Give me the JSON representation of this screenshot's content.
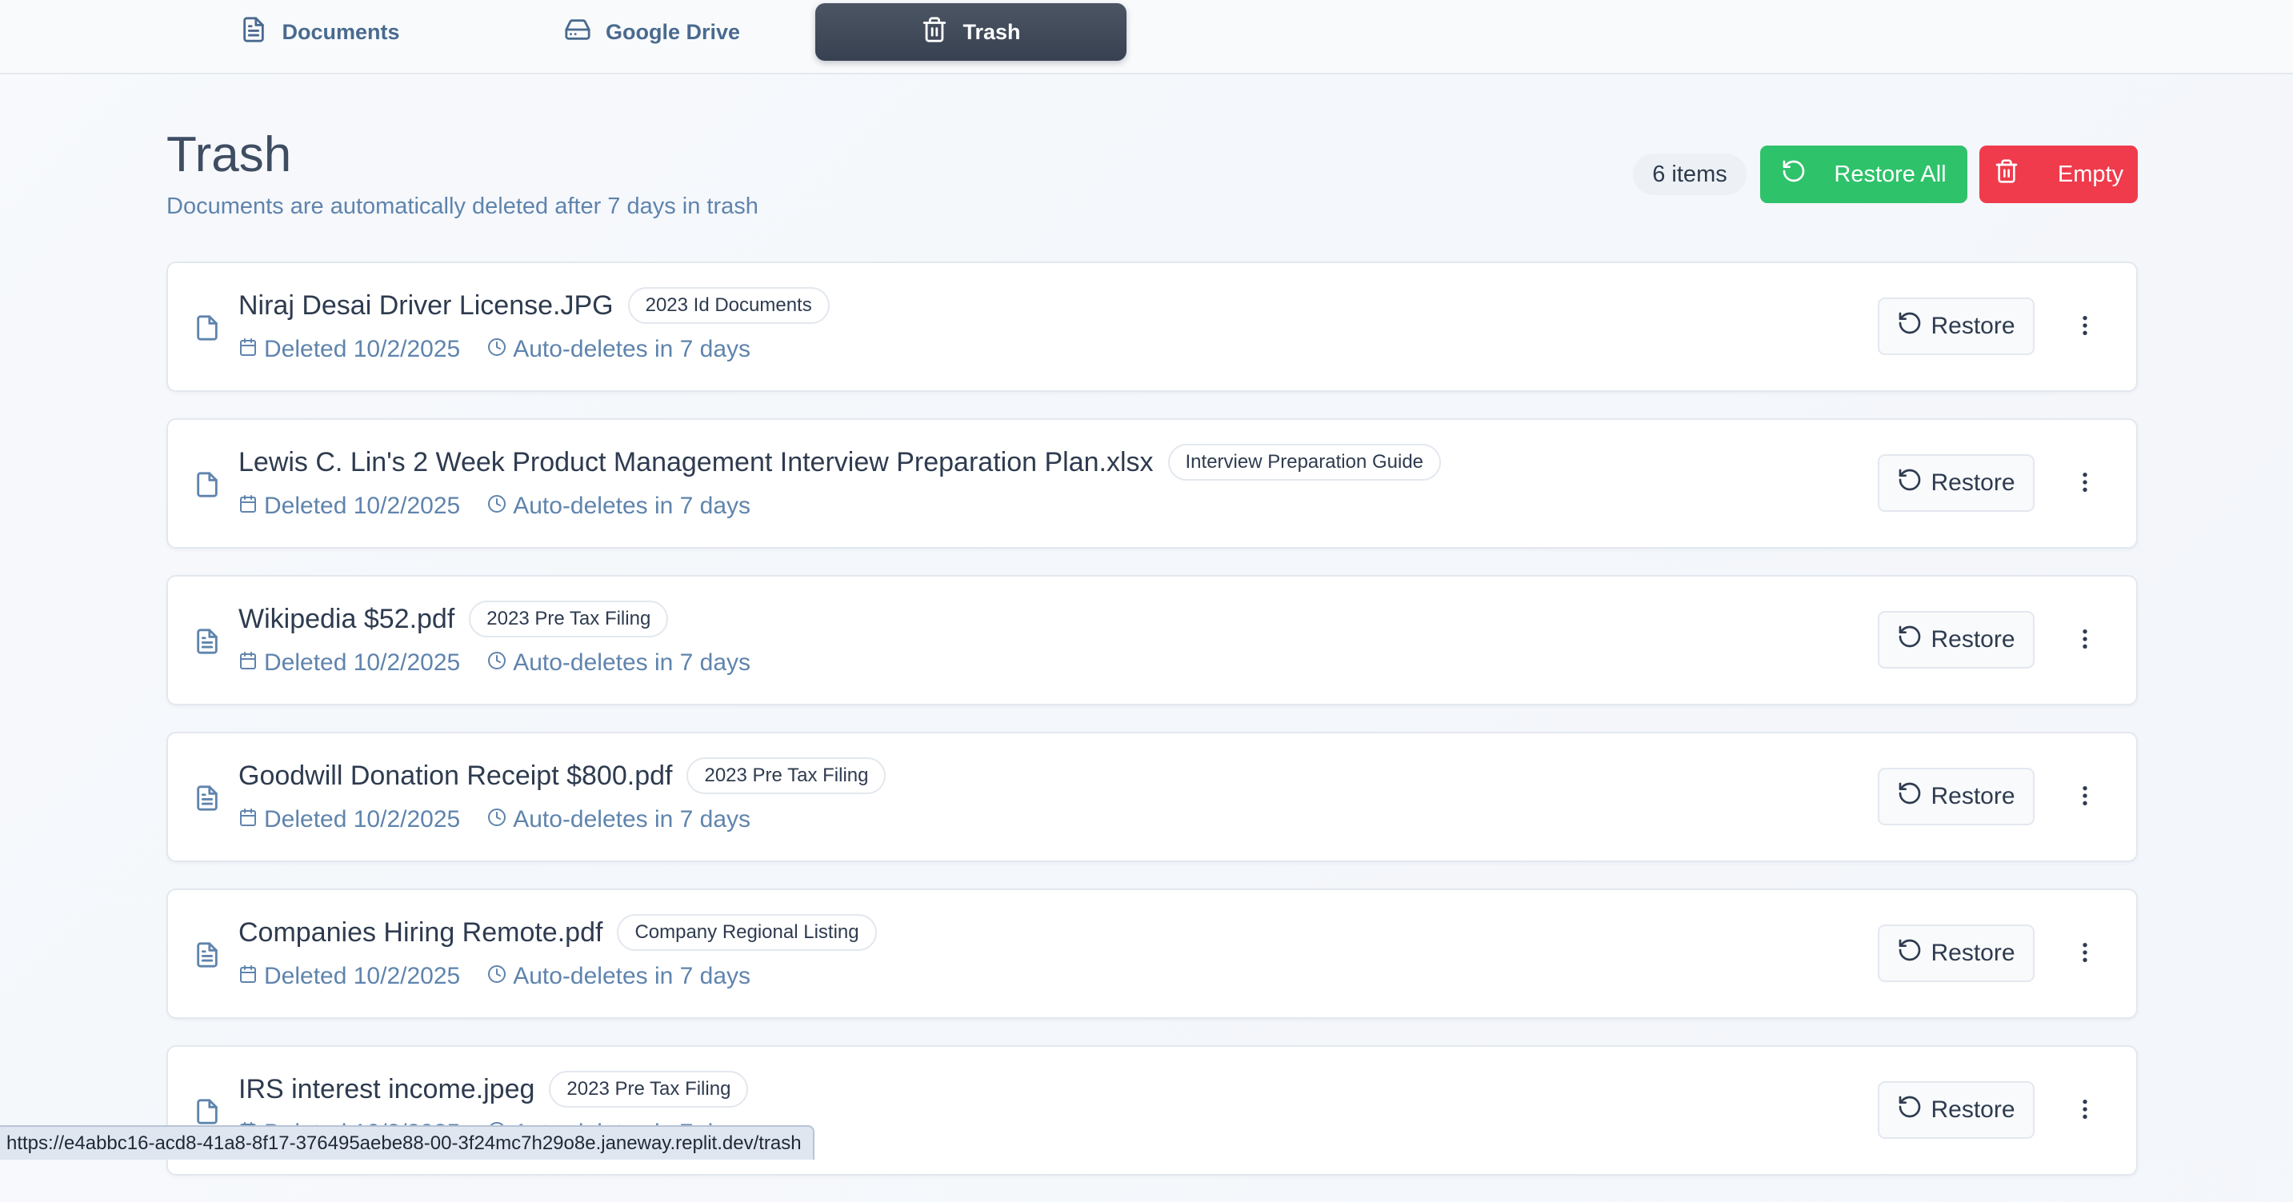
{
  "nav": {
    "tabs": [
      {
        "label": "Documents",
        "icon": "document-icon",
        "active": false
      },
      {
        "label": "Google Drive",
        "icon": "drive-icon",
        "active": false
      },
      {
        "label": "Trash",
        "icon": "trash-icon",
        "active": true
      }
    ]
  },
  "header": {
    "title": "Trash",
    "subtitle": "Documents are automatically deleted after 7 days in trash",
    "item_count": "6 items",
    "restore_all_label": "Restore All",
    "empty_label": "Empty"
  },
  "items": [
    {
      "name": "Niraj Desai Driver License.JPG",
      "folder": "2023 Id Documents",
      "deleted": "Deleted 10/2/2025",
      "auto_delete": "Auto-deletes in 7 days",
      "restore_label": "Restore",
      "icon": "file-icon"
    },
    {
      "name": "Lewis C. Lin's 2 Week Product Management Interview Preparation Plan.xlsx",
      "folder": "Interview Preparation Guide",
      "deleted": "Deleted 10/2/2025",
      "auto_delete": "Auto-deletes in 7 days",
      "restore_label": "Restore",
      "icon": "file-icon"
    },
    {
      "name": "Wikipedia $52.pdf",
      "folder": "2023 Pre Tax Filing",
      "deleted": "Deleted 10/2/2025",
      "auto_delete": "Auto-deletes in 7 days",
      "restore_label": "Restore",
      "icon": "file-text-icon"
    },
    {
      "name": "Goodwill Donation Receipt $800.pdf",
      "folder": "2023 Pre Tax Filing",
      "deleted": "Deleted 10/2/2025",
      "auto_delete": "Auto-deletes in 7 days",
      "restore_label": "Restore",
      "icon": "file-text-icon"
    },
    {
      "name": "Companies Hiring Remote.pdf",
      "folder": "Company Regional Listing",
      "deleted": "Deleted 10/2/2025",
      "auto_delete": "Auto-deletes in 7 days",
      "restore_label": "Restore",
      "icon": "file-text-icon"
    },
    {
      "name": "IRS interest income.jpeg",
      "folder": "2023 Pre Tax Filing",
      "deleted": "Deleted 10/2/2025",
      "auto_delete": "Auto-deletes in 7 days",
      "restore_label": "Restore",
      "icon": "file-icon"
    }
  ],
  "status_bar": {
    "url": "https://e4abbc16-acd8-41a8-8f17-376495aebe88-00-3f24mc7h29o8e.janeway.replit.dev/trash"
  },
  "colors": {
    "accent_dark": "#374151",
    "restore_all_green": "#2ec26a",
    "empty_red": "#ef3b4c",
    "meta_blue": "#5f84ad"
  }
}
